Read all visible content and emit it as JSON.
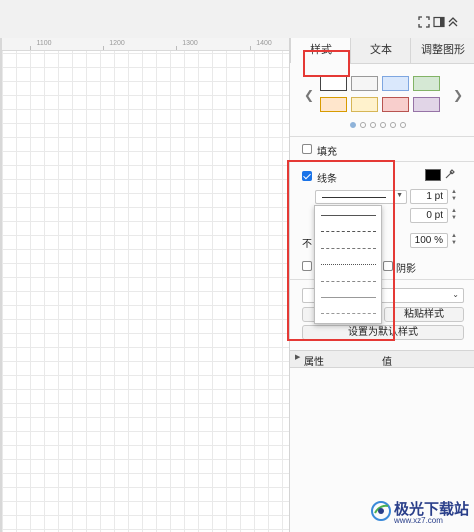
{
  "toolbar": {
    "icons": [
      "fullscreen-icon",
      "format-panel-icon",
      "collapse-up-icon"
    ]
  },
  "ruler": {
    "ticks": [
      "1100",
      "1200",
      "1300",
      "1400"
    ]
  },
  "panel": {
    "tabs": [
      {
        "label": "样式",
        "active": true
      },
      {
        "label": "文本",
        "active": false
      },
      {
        "label": "调整图形",
        "active": false
      }
    ],
    "swatches": {
      "row1": [
        "#ffffff",
        "#f5f5f5",
        "#dae8fc",
        "#d5e8d4"
      ],
      "row2": [
        "#ffe6cc",
        "#fff2cc",
        "#f8cecc",
        "#e1d5e7"
      ],
      "page_dots": 6,
      "active_dot": 0
    },
    "fill": {
      "label": "填充",
      "checked": false
    },
    "line": {
      "label": "线条",
      "checked": true,
      "color": "#000000",
      "width_value": "1 pt",
      "spacing_value": "0 pt"
    },
    "opacity": {
      "label_visible": "不",
      "value": "100 %"
    },
    "shadow": {
      "label": "阴影",
      "checked": false
    },
    "buttons": {
      "paste_style": "粘贴样式",
      "set_default_style": "设置为默认样式"
    },
    "properties": {
      "col_property": "属性",
      "col_value": "值"
    }
  },
  "dropdown": {
    "options": [
      "solid",
      "dashed",
      "dashed-fine",
      "dotted",
      "dash-dot",
      "solid-thin",
      "dashed-long"
    ]
  },
  "watermark": {
    "text": "极光下载站",
    "url": "www.xz7.com"
  },
  "colors": {
    "accent": "#1a73e8",
    "highlight": "#e53935",
    "watermark": "#2a3f8a"
  }
}
